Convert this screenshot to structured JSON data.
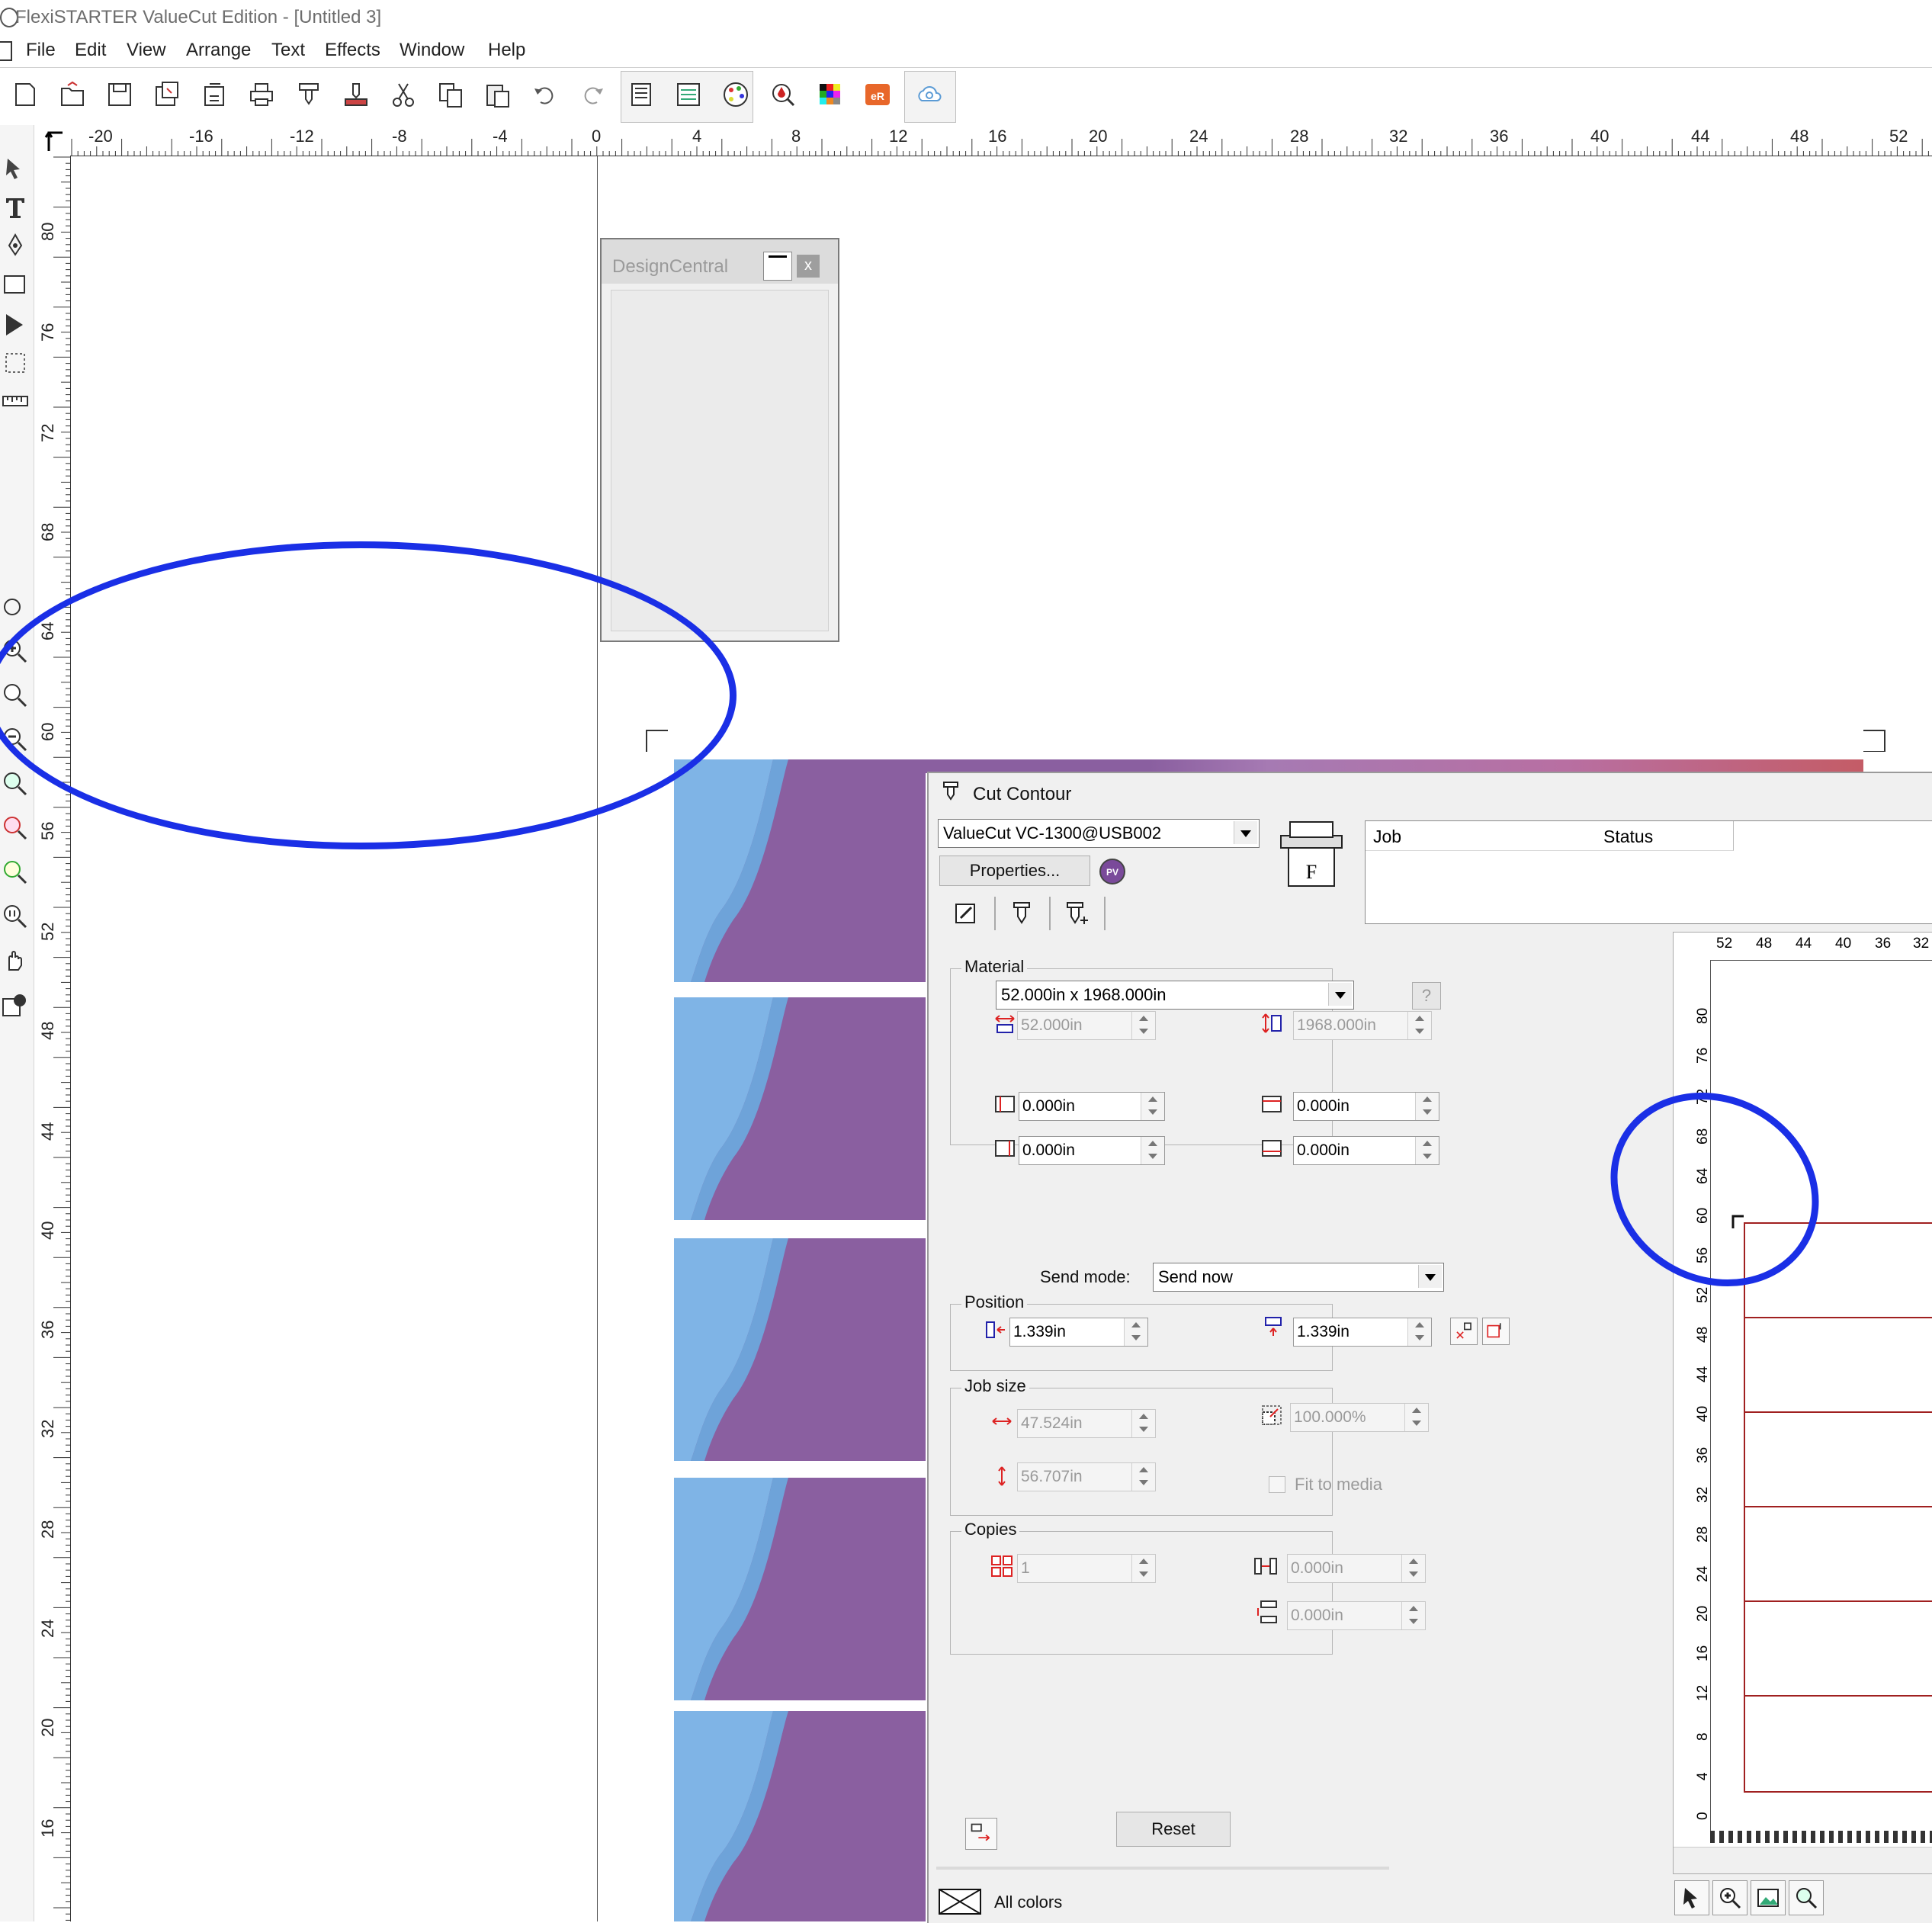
{
  "window": {
    "title": "FlexiSTARTER ValueCut Edition - [Untitled 3]"
  },
  "menu": [
    "File",
    "Edit",
    "View",
    "Arrange",
    "Text",
    "Effects",
    "Window",
    "Help"
  ],
  "toolbar": {
    "icons": [
      "new-document-icon",
      "open-icon",
      "save-icon",
      "save-as-icon",
      "import-icon",
      "print-icon",
      "cut-plot-icon",
      "rip-and-print-icon",
      "scissors-icon",
      "copy-icon",
      "paste-icon",
      "undo-icon",
      "redo-icon",
      "job-setup-icon",
      "production-manager-icon",
      "color-palette-icon",
      "color-drop-icon",
      "swatch-grid-icon",
      "er-icon",
      "cloud-icon"
    ],
    "er_label": "eR"
  },
  "rulers": {
    "horizontal": [
      "-20",
      "-16",
      "-12",
      "-8",
      "-4",
      "0",
      "4",
      "8",
      "12",
      "16",
      "20",
      "24",
      "28",
      "32",
      "36",
      "40",
      "44",
      "48",
      "52"
    ],
    "vertical": [
      "80",
      "76",
      "72",
      "68",
      "64",
      "60",
      "56",
      "52",
      "48",
      "44",
      "40",
      "36",
      "32",
      "28",
      "24",
      "20",
      "16"
    ]
  },
  "design_central": {
    "title": "DesignCentral",
    "close": "x"
  },
  "cut_contour": {
    "title": "Cut Contour",
    "device": "ValueCut VC-1300@USB002",
    "properties_label": "Properties...",
    "pv_label": "PV",
    "job_columns": [
      "Job",
      "Status"
    ],
    "material": {
      "label": "Material",
      "size": "52.000in x 1968.000in",
      "help": "?",
      "width": "52.000in",
      "height": "1968.000in",
      "margin_left": "0.000in",
      "margin_top": "0.000in",
      "margin_right": "0.000in",
      "margin_bottom": "0.000in"
    },
    "send_mode": {
      "label": "Send mode:",
      "value": "Send now"
    },
    "position": {
      "label": "Position",
      "x": "1.339in",
      "y": "1.339in"
    },
    "job_size": {
      "label": "Job size",
      "width": "47.524in",
      "height": "56.707in",
      "scale": "100.000%",
      "fit_to_media": "Fit to media"
    },
    "copies": {
      "label": "Copies",
      "count": "1",
      "h_spacing": "0.000in",
      "v_spacing": "0.000in"
    },
    "reset_label": "Reset",
    "all_colors_label": "All colors"
  },
  "preview": {
    "h_labels": [
      "52",
      "48",
      "44",
      "40",
      "36",
      "32"
    ],
    "v_labels": [
      "80",
      "76",
      "72",
      "68",
      "64",
      "60",
      "56",
      "52",
      "48",
      "44",
      "40",
      "36",
      "32",
      "28",
      "24",
      "20",
      "16",
      "12",
      "8",
      "4",
      "0"
    ]
  },
  "colors": {
    "strip_purple": "#8a5fa0",
    "strip_blue": "#7fb4e6",
    "annotation": "#1a2fe6",
    "preview_border": "#a02020"
  }
}
